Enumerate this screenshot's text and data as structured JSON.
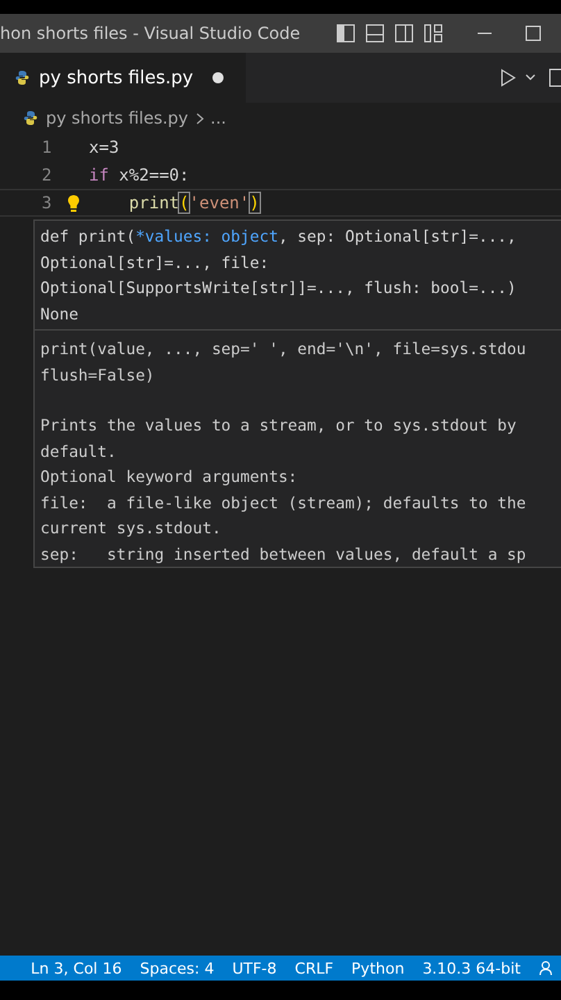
{
  "window": {
    "title": "hon shorts files - Visual Studio Code"
  },
  "tabs": [
    {
      "label": "py shorts files.py",
      "selected": true,
      "modified": true
    }
  ],
  "breadcrumb": [
    "py shorts files.py",
    "..."
  ],
  "code_lines": [
    {
      "number": "1",
      "current": false,
      "lightbulb": false,
      "tokens": [
        {
          "kind": "plain",
          "text": "x=3"
        }
      ]
    },
    {
      "number": "2",
      "current": false,
      "lightbulb": false,
      "tokens": [
        {
          "kind": "keyword",
          "text": "if"
        },
        {
          "kind": "plain",
          "text": " x%2==0:"
        }
      ]
    },
    {
      "number": "3",
      "current": true,
      "lightbulb": true,
      "tokens": [
        {
          "kind": "function",
          "text": "    print"
        },
        {
          "kind": "bracket",
          "text": "("
        },
        {
          "kind": "string",
          "text": "'even'"
        },
        {
          "kind": "bracket",
          "text": ")"
        }
      ]
    }
  ],
  "hover": {
    "signature": [
      [
        {
          "kind": "plain",
          "text": "def print("
        },
        {
          "kind": "active",
          "text": "*values: object"
        },
        {
          "kind": "plain",
          "text": ", sep: Optional[str]=...,"
        }
      ],
      [
        {
          "kind": "plain",
          "text": "Optional[str]=..., file:"
        }
      ],
      [
        {
          "kind": "plain",
          "text": "Optional[SupportsWrite[str]]=..., flush: bool=...)"
        }
      ],
      [
        {
          "kind": "plain",
          "text": "None"
        }
      ]
    ],
    "doc": [
      [
        "print(value, ..., sep=' ', end='\\n', file=sys.stdou",
        "flush=False)"
      ],
      [
        "Prints the values to a stream, or to sys.stdout by",
        "default.",
        "Optional keyword arguments:",
        "file:  a file-like object (stream); defaults to the",
        "current sys.stdout.",
        "sep:   string inserted between values, default a sp"
      ]
    ]
  },
  "status_bar": [
    "Ln 3, Col 16",
    "Spaces: 4",
    "UTF-8",
    "CRLF",
    "Python",
    "3.10.3 64-bit"
  ]
}
